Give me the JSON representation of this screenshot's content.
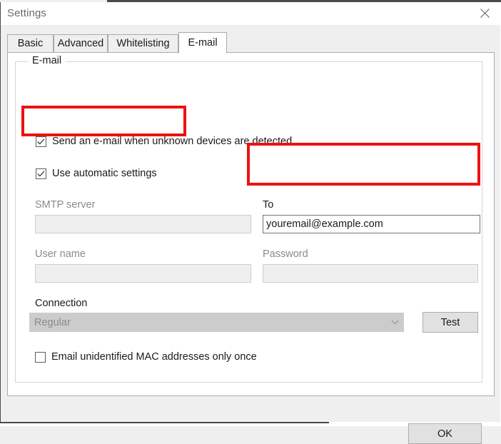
{
  "window": {
    "title": "Settings",
    "close_icon": "close-icon"
  },
  "tabs": [
    {
      "label": "Basic",
      "active": false
    },
    {
      "label": "Advanced",
      "active": false
    },
    {
      "label": "Whitelisting",
      "active": false
    },
    {
      "label": "E-mail",
      "active": true
    }
  ],
  "group": {
    "title": "E-mail"
  },
  "checkboxes": {
    "send_email": {
      "label": "Send an e-mail when unknown devices are detected",
      "checked": true
    },
    "use_automatic_settings": {
      "label": "Use automatic settings",
      "checked": true
    },
    "email_once": {
      "label": "Email unidentified MAC addresses only once",
      "checked": false
    }
  },
  "fields": {
    "smtp_server": {
      "label": "SMTP server",
      "value": "",
      "placeholder": "",
      "disabled": true
    },
    "to": {
      "label": "To",
      "value": "youremail@example.com",
      "placeholder": "",
      "disabled": false
    },
    "user_name": {
      "label": "User name",
      "value": "",
      "placeholder": "",
      "disabled": true
    },
    "password": {
      "label": "Password",
      "value": "",
      "placeholder": "",
      "disabled": true
    },
    "connection": {
      "label": "Connection",
      "value": "Regular",
      "options": [
        "Regular"
      ],
      "disabled": true,
      "arrow_icon": "chevron-down-icon"
    }
  },
  "buttons": {
    "test": "Test",
    "ok": "OK"
  },
  "annotations": {
    "accent_color": "#ee1111",
    "boxes": [
      {
        "name": "use-automatic-settings"
      },
      {
        "name": "to-field"
      }
    ]
  }
}
